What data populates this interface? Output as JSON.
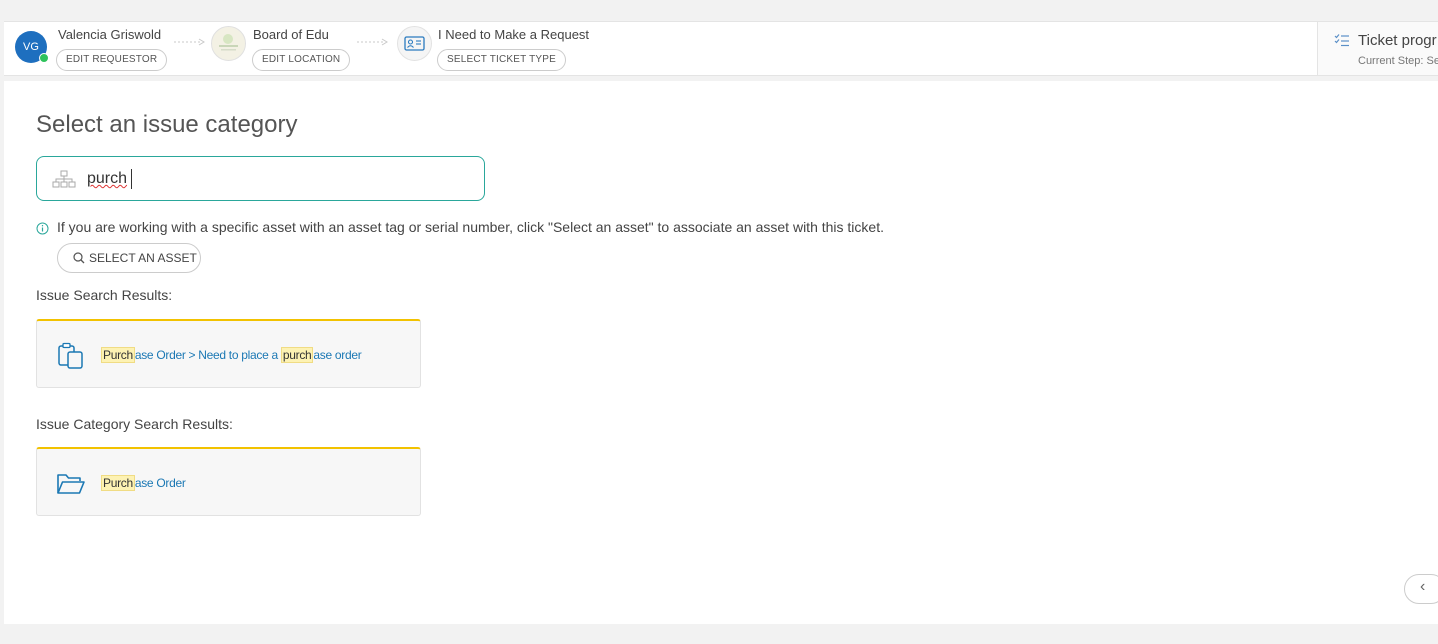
{
  "breadcrumb": {
    "requestor": {
      "initials": "VG",
      "name": "Valencia Griswold",
      "button": "EDIT REQUESTOR"
    },
    "location": {
      "name": "Board of Edu",
      "button": "EDIT LOCATION"
    },
    "ticket_type": {
      "name": "I Need to Make a Request",
      "button": "SELECT TICKET TYPE"
    }
  },
  "progress": {
    "title": "Ticket progr",
    "subtitle": "Current Step: Se"
  },
  "main": {
    "title": "Select an issue category",
    "search": {
      "value": "purch"
    },
    "info_text": "If you are working with a specific asset with an asset tag or serial number, click \"Select an asset\" to associate an asset with this ticket.",
    "select_asset_button": "SELECT AN ASSET",
    "issue_results_label": "Issue Search Results:",
    "issue_results": [
      {
        "icon": "clipboard-icon",
        "parts": [
          "Purch",
          "ase Order > Need to place a ",
          "purch",
          "ase order"
        ]
      }
    ],
    "category_results_label": "Issue Category Search Results:",
    "category_results": [
      {
        "icon": "folder-open-icon",
        "parts": [
          "Purch",
          "ase Order"
        ]
      }
    ],
    "back_button": "‹"
  },
  "colors": {
    "accent": "#2aa79b",
    "link": "#1b78b4",
    "highlight": "#fdf2b3",
    "card_top": "#f2c200",
    "avatar": "#1e6fbf"
  }
}
